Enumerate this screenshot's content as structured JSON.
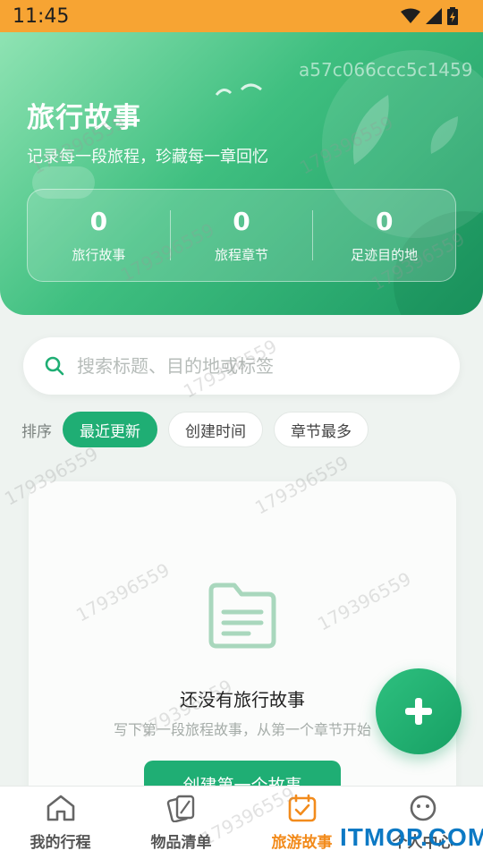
{
  "status_bar": {
    "time": "11:45"
  },
  "header": {
    "title": "旅行故事",
    "subtitle": "记录每一段旅程，珍藏每一章回忆",
    "stats": [
      {
        "value": "0",
        "label": "旅行故事"
      },
      {
        "value": "0",
        "label": "旅程章节"
      },
      {
        "value": "0",
        "label": "足迹目的地"
      }
    ]
  },
  "search": {
    "placeholder": "搜索标题、目的地或标签"
  },
  "sort": {
    "label": "排序",
    "options": [
      "最近更新",
      "创建时间",
      "章节最多"
    ],
    "selected": "最近更新"
  },
  "empty_state": {
    "title": "还没有旅行故事",
    "description": "写下第一段旅程故事，从第一个章节开始",
    "button_label": "创建第一个故事"
  },
  "fab": {
    "icon": "plus-icon"
  },
  "bottom_nav": {
    "items": [
      {
        "label": "我的行程",
        "icon": "home-icon"
      },
      {
        "label": "物品清单",
        "icon": "cards-icon"
      },
      {
        "label": "旅游故事",
        "icon": "calendar-check-icon"
      },
      {
        "label": "个人中心",
        "icon": "face-icon"
      }
    ],
    "active": "旅游故事"
  },
  "watermark": {
    "number": "179396559",
    "hash": "a57c066ccc5c1459",
    "site_logo": "ITMOP.COM"
  },
  "colors": {
    "status_bar": "#f7a433",
    "accent_green": "#1fae74",
    "active_tab": "#f28b1c"
  }
}
